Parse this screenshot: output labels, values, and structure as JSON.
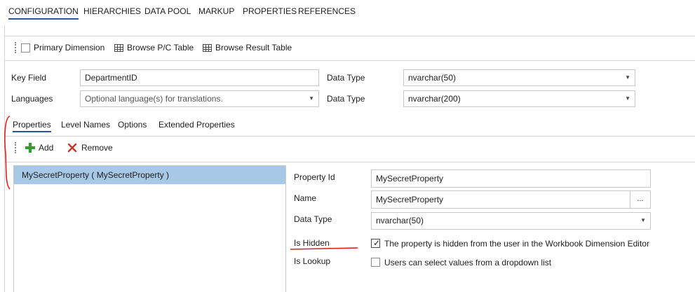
{
  "tabs": [
    "CONFIGURATION",
    "HIERARCHIES",
    "DATA POOL",
    "MARKUP",
    "PROPERTIES",
    "REFERENCES"
  ],
  "toolbar": {
    "primary_dimension": "Primary Dimension",
    "browse_pc": "Browse P/C Table",
    "browse_result": "Browse Result Table"
  },
  "key_field": {
    "label": "Key Field",
    "value": "DepartmentID",
    "data_type_label": "Data Type",
    "data_type_value": "nvarchar(50)"
  },
  "languages": {
    "label": "Languages",
    "placeholder": "Optional language(s) for translations.",
    "data_type_label": "Data Type",
    "data_type_value": "nvarchar(200)"
  },
  "sub_tabs": [
    "Properties",
    "Level Names",
    "Options",
    "Extended Properties"
  ],
  "actions": {
    "add": "Add",
    "remove": "Remove"
  },
  "property_list": [
    "MySecretProperty  ( MySecretProperty )"
  ],
  "details": {
    "property_id_label": "Property Id",
    "property_id_value": "MySecretProperty",
    "name_label": "Name",
    "name_value": "MySecretProperty",
    "name_button": "...",
    "data_type_label": "Data Type",
    "data_type_value": "nvarchar(50)",
    "is_hidden_label": "Is Hidden",
    "is_hidden_text": "The property is hidden from the user in the Workbook Dimension Editor",
    "is_hidden_checked": true,
    "is_lookup_label": "Is Lookup",
    "is_lookup_text": "Users can select values from a dropdown list",
    "is_lookup_checked": false
  },
  "colors": {
    "selection": "#a8c8e8",
    "annotation": "#e02020",
    "accent": "#2b579a",
    "add_icon": "#2e9e2e",
    "remove_icon": "#c0392b"
  }
}
